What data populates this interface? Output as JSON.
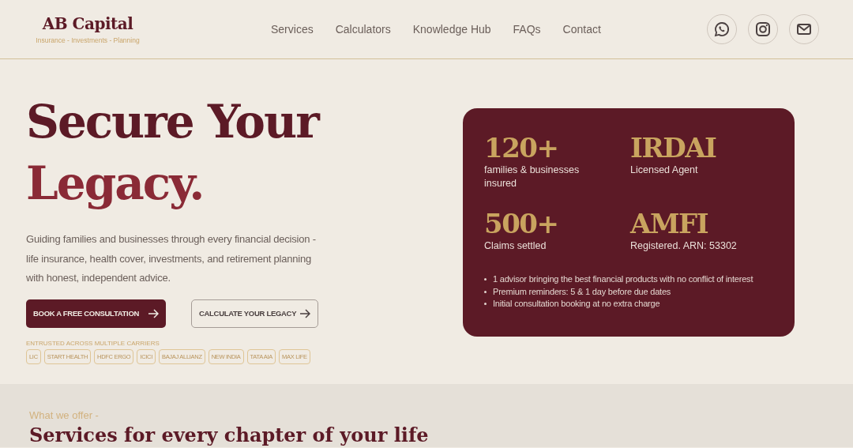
{
  "brand": {
    "name": "AB Capital",
    "tagline": "Insurance - Investments - Planning"
  },
  "nav": [
    "Services",
    "Calculators",
    "Knowledge Hub",
    "FAQs",
    "Contact"
  ],
  "social": [
    {
      "kind": "whatsapp"
    },
    {
      "kind": "instagram"
    },
    {
      "kind": "mail"
    }
  ],
  "hero": {
    "title_line_1": "Secure Your",
    "title_line_2": "Legacy.",
    "description": "Guiding families and businesses through every financial decision - life insurance, health cover, investments, and retirement planning with honest, independent advice.",
    "buttons": [
      {
        "label": "BOOK A FREE CONSULTATION",
        "kind": "primary"
      },
      {
        "label": "CALCULATE YOUR LEGACY",
        "kind": "outline"
      }
    ],
    "carriers_label": "ENTRUSTED ACROSS MULTIPLE CARRIERS",
    "carriers": [
      "LIC",
      "START HEALTH",
      "HDFC ERGO",
      "ICICI",
      "BAJAJ ALLIANZ",
      "NEW INDIA",
      "TATA AIA",
      "MAX LIFE"
    ]
  },
  "stats_card": {
    "stats": [
      {
        "value": "120+",
        "label": "families & businesses insured"
      },
      {
        "value": "IRDAI",
        "label": "Licensed Agent"
      },
      {
        "value": "500+",
        "label": "Claims settled"
      },
      {
        "value": "AMFI",
        "label": "Registered. ARN: 53302"
      }
    ],
    "points": [
      "1 advisor bringing the best financial products with no conflict of interest",
      "Premium reminders:  5 & 1 day before due dates",
      "Initial consultation booking at no extra charge"
    ]
  },
  "services": {
    "eyebrow": "What we offer -",
    "title": "Services for every chapter of your life"
  }
}
